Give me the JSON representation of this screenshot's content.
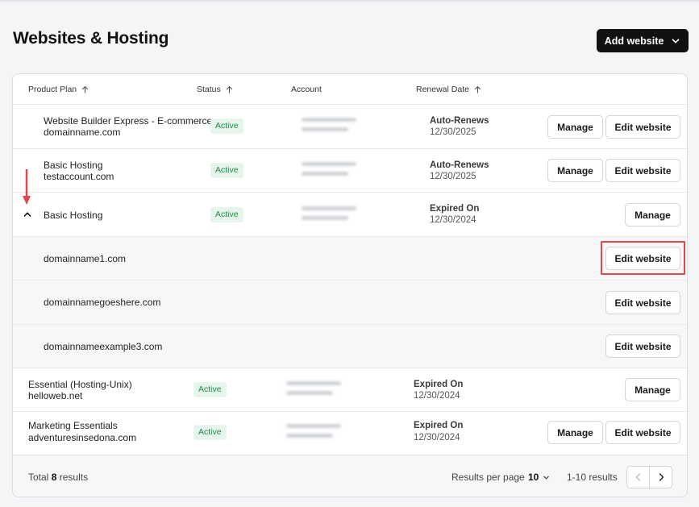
{
  "page": {
    "title": "Websites & Hosting",
    "add_button": "Add website"
  },
  "columns": {
    "product_plan": "Product Plan",
    "status": "Status",
    "account": "Account",
    "renewal_date": "Renewal Date"
  },
  "buttons": {
    "manage": "Manage",
    "edit": "Edit website"
  },
  "rows": [
    {
      "plan": "Website Builder Express - E-commerce",
      "domain": "domainname.com",
      "status": "Active",
      "renewal_label": "Auto-Renews",
      "renewal_date": "12/30/2025"
    },
    {
      "plan": "Basic Hosting",
      "domain": "testaccount.com",
      "status": "Active",
      "renewal_label": "Auto-Renews",
      "renewal_date": "12/30/2025"
    },
    {
      "plan": "Basic Hosting",
      "status": "Active",
      "renewal_label": "Expired On",
      "renewal_date": "12/30/2024",
      "subdomains": [
        "domainname1.com",
        "domainnamegoeshere.com",
        "domainnameexample3.com"
      ]
    },
    {
      "plan": "Essential (Hosting-Unix)",
      "domain": "helloweb.net",
      "status": "Active",
      "renewal_label": "Expired On",
      "renewal_date": "12/30/2024"
    },
    {
      "plan": "Marketing Essentials",
      "domain": "adventuresinsedona.com",
      "status": "Active",
      "renewal_label": "Expired On",
      "renewal_date": "12/30/2024"
    }
  ],
  "footer": {
    "total_prefix": "Total",
    "total_count": "8",
    "total_suffix": "results",
    "rpp_label": "Results per page",
    "rpp_value": "10",
    "range": "1-10 results"
  },
  "colors": {
    "accent": "#111111",
    "active_badge_bg": "#e6f5ec",
    "active_badge_text": "#1f8a4c",
    "annotation": "#e0484b"
  },
  "icons": {
    "add": "chevron-down-icon",
    "sort": "arrow-up-icon",
    "expand": "chevron-up-icon",
    "prev": "chevron-left-icon",
    "next": "chevron-right-icon",
    "annotation": "arrow-down-icon"
  }
}
